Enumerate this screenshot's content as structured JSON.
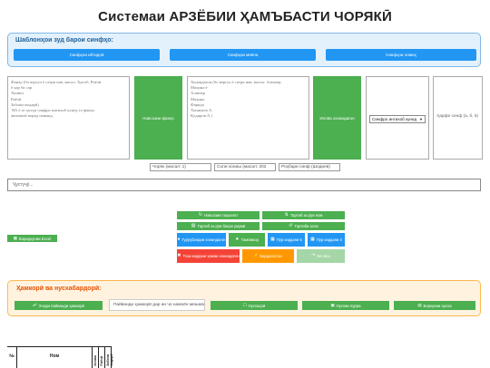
{
  "page": {
    "title": "Системаи АРЗЁБИИ ҲАМЪБАСТИ ЧОРЯКӢ"
  },
  "templates": {
    "heading": "Шаблонҳои зуд барои синфҳо:",
    "buttons": [
      "Синфҳои ибтидоӣ",
      "Синфҳои миёна",
      "Синфҳои олиюҳ"
    ]
  },
  "students_input": {
    "placeholder": "Фанҳо (бо вергул ё сатри нав, масал: Ҳисоб, Риёзӣ\nё ҳар ба сар\nХониш\nРиёзӣ\nЗабони модарӣ)\n ВА ё аз ҳолҳи синфро интихоб кунед то фанҳо\nавтоматӣ ворид шаванд"
  },
  "add_subjects_button": "Навсозии фанҳо",
  "teachers_input": {
    "placeholder": "Хонандагон (бо вергул ё сатри нав, масал: Алишер,\nМаҳина ё\nАлишер\nМаҳина\nФарида\nХашимов А.\nҚодиров А.)"
  },
  "add_students_button": "Илова хонандагон",
  "class_select": {
    "value": "Синфро интихоб кунед",
    "arrow": "chevron-down-icon"
  },
  "class_letter": {
    "placeholder": "Ҳарфи синф (а, б, в)"
  },
  "inputs": {
    "quarter": "Чоряк (масал: 1)",
    "year": "Соли хониш (масал: 202",
    "leader": "Роҳбари синф (Шодиев)"
  },
  "search": {
    "placeholder": "Ҷустуҷӯ..."
  },
  "excel_button": "Воридкунии Excel",
  "tools": [
    {
      "label": "Навсозии таҳсилот",
      "icon": "refresh-icon",
      "color": "#4caf50"
    },
    {
      "label": "Тартиб аз рӯи ном",
      "icon": "sort-icon",
      "color": "#4caf50"
    },
    {
      "label": "Тартиб аз рӯи баҳои умумӣ",
      "icon": "chart-icon",
      "color": "#4caf50"
    },
    {
      "label": "Тартиби асли",
      "icon": "reset-icon",
      "color": "#4caf50"
    },
    {
      "label": "Гурӯҳбандии хонандагон",
      "icon": "group-icon",
      "color": "#2196f3"
    },
    {
      "label": "Тамомкор",
      "icon": "star-icon",
      "color": "#4caf50"
    },
    {
      "label": "Пур кардани 5",
      "icon": "grid-icon",
      "color": "#2196f3"
    },
    {
      "label": "Пур кардани 4",
      "icon": "grid-icon",
      "color": "#2196f3"
    },
    {
      "label": "Тоза кардани ҳамаи хонандагон",
      "icon": "close-icon",
      "color": "#f44336"
    },
    {
      "label": "Барқасохтан",
      "icon": "check-icon",
      "color": "#ff9800"
    },
    {
      "label": "Ба пеш",
      "icon": "redo-icon",
      "color": "#a5d6a7"
    }
  ],
  "collab": {
    "heading": "Ҳамкорӣ ва нусхабардорӣ:",
    "create_link": "Эҷоди пайванди ҳамкорӣ",
    "link_placeholder": "Пайванди ҳамкорӣ дар ин ҷо намоён мешавад",
    "copy": "Нусхаҳоӣ",
    "save_copy": "Нусхаи пурра",
    "load_copy": "Боркунии нусха"
  },
  "table": {
    "headers": [
      "№",
      "Ном"
    ],
    "vertical_headers": [
      "Хониш",
      "Риёзӣ",
      "Забони модарӣ"
    ]
  }
}
